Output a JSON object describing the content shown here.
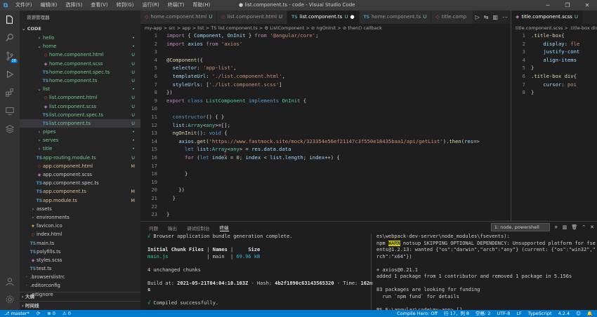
{
  "window": {
    "title": "● list.component.ts - code - Visual Studio Code",
    "menu": [
      "文件(F)",
      "编辑(E)",
      "选择(S)",
      "查看(V)",
      "转到(G)",
      "运行(R)",
      "终端(T)",
      "帮助(H)"
    ]
  },
  "activity": {
    "badge": "28"
  },
  "explorer": {
    "title": "资源管理器",
    "section": "CODE",
    "items": [
      {
        "label": "hello",
        "indent": 1,
        "type": "folder",
        "color": "new",
        "badge": "•"
      },
      {
        "label": "home",
        "indent": 1,
        "type": "folder-open",
        "color": "new",
        "badge": "•"
      },
      {
        "label": "home.component.html",
        "indent": 2,
        "type": "ang",
        "color": "new",
        "badge": "U"
      },
      {
        "label": "home.component.scss",
        "indent": 2,
        "type": "css",
        "color": "new",
        "badge": "U"
      },
      {
        "label": "home.component.spec.ts",
        "indent": 2,
        "type": "ts",
        "color": "new",
        "badge": "U"
      },
      {
        "label": "home.component.ts",
        "indent": 2,
        "type": "ts",
        "color": "new",
        "badge": "U"
      },
      {
        "label": "list",
        "indent": 1,
        "type": "folder-open",
        "color": "new",
        "badge": "•"
      },
      {
        "label": "list.component.html",
        "indent": 2,
        "type": "ang",
        "color": "new",
        "badge": "U"
      },
      {
        "label": "list.component.scss",
        "indent": 2,
        "type": "css",
        "color": "new",
        "badge": "U"
      },
      {
        "label": "list.component.spec.ts",
        "indent": 2,
        "type": "ts",
        "color": "new",
        "badge": "U"
      },
      {
        "label": "list.component.ts",
        "indent": 2,
        "type": "ts",
        "color": "new",
        "badge": "U",
        "selected": true
      },
      {
        "label": "pipes",
        "indent": 1,
        "type": "folder",
        "color": "new",
        "badge": "•"
      },
      {
        "label": "serves",
        "indent": 1,
        "type": "folder",
        "color": "new",
        "badge": "•"
      },
      {
        "label": "title",
        "indent": 1,
        "type": "folder",
        "color": "new",
        "badge": "•"
      },
      {
        "label": "app-routing.module.ts",
        "indent": 1,
        "type": "ts",
        "color": "new",
        "badge": "U"
      },
      {
        "label": "app.component.html",
        "indent": 1,
        "type": "ang",
        "color": "mod",
        "badge": "M"
      },
      {
        "label": "app.component.scss",
        "indent": 1,
        "type": "css",
        "color": "plain",
        "badge": ""
      },
      {
        "label": "app.component.spec.ts",
        "indent": 1,
        "type": "ts",
        "color": "plain",
        "badge": ""
      },
      {
        "label": "app.component.ts",
        "indent": 1,
        "type": "ts",
        "color": "mod",
        "badge": "M"
      },
      {
        "label": "app.module.ts",
        "indent": 1,
        "type": "ts",
        "color": "mod",
        "badge": "M"
      },
      {
        "label": "assets",
        "indent": 0,
        "type": "folder",
        "color": "plain",
        "badge": ""
      },
      {
        "label": "environments",
        "indent": 0,
        "type": "folder",
        "color": "plain",
        "badge": ""
      },
      {
        "label": "favicon.ico",
        "indent": 0,
        "type": "json",
        "color": "plain",
        "badge": ""
      },
      {
        "label": "index.html",
        "indent": 0,
        "type": "html",
        "color": "plain",
        "badge": ""
      },
      {
        "label": "main.ts",
        "indent": 0,
        "type": "ts",
        "color": "plain",
        "badge": ""
      },
      {
        "label": "polyfills.ts",
        "indent": 0,
        "type": "ts",
        "color": "plain",
        "badge": ""
      },
      {
        "label": "styles.scss",
        "indent": 0,
        "type": "css",
        "color": "plain",
        "badge": ""
      },
      {
        "label": "test.ts",
        "indent": 0,
        "type": "ts",
        "color": "plain",
        "badge": ""
      },
      {
        "label": ".browserslistrc",
        "indent": -1,
        "type": "file",
        "color": "plain",
        "badge": ""
      },
      {
        "label": ".editorconfig",
        "indent": -1,
        "type": "file",
        "color": "plain",
        "badge": ""
      },
      {
        "label": ".gitignore",
        "indent": -1,
        "type": "file",
        "color": "plain",
        "badge": ""
      }
    ],
    "outline": "大纲",
    "timeline": "时间线"
  },
  "tabs": [
    {
      "label": "home.component.html",
      "type": "ang",
      "status": "U"
    },
    {
      "label": "list.component.html",
      "type": "ang",
      "status": "U"
    },
    {
      "label": "list.component.ts",
      "type": "ts",
      "status": "U",
      "active": true,
      "dirty": "●"
    },
    {
      "label": "home.component.ts",
      "type": "ts",
      "status": "U"
    },
    {
      "label": "title.comp",
      "type": "ang",
      "status": ""
    }
  ],
  "breadcrumb": "my-app > src > app > list > TS list.component.ts > ⚙ ListComponent > ⊘ ngOnInit > ⊘ then() callback",
  "code": {
    "lines": [
      {
        "n": "1",
        "h": "<span class='k'>import</span> { <span class='v'>Component</span>, <span class='v'>OnInit</span> } <span class='k'>from</span> <span class='s'>'@angular/core'</span>;"
      },
      {
        "n": "2",
        "h": "<span class='k'>import</span> <span class='v'>axios</span> <span class='k'>from</span> <span class='s'>'axios'</span>"
      },
      {
        "n": "3",
        "h": ""
      },
      {
        "n": "4",
        "h": "@<span class='d'>Component</span>({"
      },
      {
        "n": "5",
        "h": "  <span class='v'>selector</span>: <span class='s'>'app-list'</span>,"
      },
      {
        "n": "6",
        "h": "  <span class='v'>templateUrl</span>: <span class='s'>'./list.component.html'</span>,"
      },
      {
        "n": "7",
        "h": "  <span class='v'>styleUrls</span>: [<span class='s'>'./list.component.scss'</span>]"
      },
      {
        "n": "8",
        "h": "})"
      },
      {
        "n": "9",
        "h": "<span class='k'>export</span> <span class='kb'>class</span> <span class='t'>ListComponent</span> <span class='kb'>implements</span> <span class='t'>OnInit</span> {"
      },
      {
        "n": "10",
        "h": ""
      },
      {
        "n": "11",
        "h": "  <span class='kb'>constructor</span>() { }"
      },
      {
        "n": "12",
        "h": "  <span class='v'>list</span>:<span class='t'>Array</span>&lt;<span class='t'>any</span>&gt;=[];"
      },
      {
        "n": "13",
        "h": "  <span class='f'>ngOnInit</span>(): <span class='kb'>void</span> {"
      },
      {
        "n": "14",
        "h": "    <span class='v'>axios</span>.<span class='f'>get</span>(<span class='s'>'https://www.fastmock.site/mock/323354e56ef21147c3f550e18435baa1/api/getList'</span>).<span class='f'>then</span>(<span class='v'>res</span>=&gt;"
      },
      {
        "n": "15",
        "h": "      <span class='kb'>let</span> <span class='v'>list</span>:<span class='t'>Array</span>&lt;<span class='t'>any</span>&gt; = <span class='v'>res</span>.<span class='v'>data</span>.<span class='v'>data</span>"
      },
      {
        "n": "16",
        "h": "      <span class='k'>for</span> (<span class='kb'>let</span> <span class='v'>index</span> = <span class='n'>0</span>; <span class='v'>index</span> &lt; <span class='v'>list</span>.<span class='v'>length</span>; <span class='v'>index</span>++) {"
      },
      {
        "n": "17",
        "h": "        "
      },
      {
        "n": "18",
        "h": "      }"
      },
      {
        "n": "19",
        "h": ""
      },
      {
        "n": "20",
        "h": "    })"
      },
      {
        "n": "21",
        "h": "  }"
      },
      {
        "n": "22",
        "h": ""
      },
      {
        "n": "23",
        "h": "}"
      }
    ]
  },
  "editor2": {
    "tab": "title.component.scss",
    "status": "U",
    "breadcrumb": "title.component.scss > .title-box div",
    "lines": [
      {
        "n": "1",
        "h": ".<span class='d'>title-box</span>{"
      },
      {
        "n": "2",
        "h": "    <span class='v'>display</span>: <span class='s'>fle</span>"
      },
      {
        "n": "3",
        "h": "    <span class='v'>justify-cont</span>"
      },
      {
        "n": "4",
        "h": "    <span class='v'>align-items</span>"
      },
      {
        "n": "5",
        "h": "}"
      },
      {
        "n": "6",
        "h": ".<span class='d'>title-box</span> <span class='d'>div</span>{"
      },
      {
        "n": "7",
        "h": "    <span class='v'>cursor</span>: <span class='s'>poi</span>"
      },
      {
        "n": "8",
        "h": "}"
      }
    ]
  },
  "panel": {
    "tabs": [
      "问题",
      "输出",
      "调试控制台",
      "终端"
    ],
    "active": "终端",
    "terminal_select": "1: node, powershell",
    "left": [
      "<span class='t-green'>√</span> Browser application bundle generation complete.",
      "",
      "<span class='t-bold'>Initial Chunk Files</span> | <span class='t-bold'>Names</span> |     <span class='t-bold'>Size</span>",
      "<span class='t-green'>main.js</span>             | main  | <span class='t-cyan'>69.96 kB</span>",
      "",
      "4 unchanged chunks",
      "",
      "Build at: <span class='t-bold'>2021-05-21T04:04:10.103Z</span> - Hash: <span class='t-bold'>4b2f1890c63143565320</span> - Time: <span class='t-bold'>162m</span>",
      "<span class='t-bold'>s</span>",
      "",
      "<span class='t-green'>√</span> Compiled successfully."
    ],
    "right": [
      "es\\webpack-dev-server\\node_modules\\fsevents):",
      "npm <span class='t-hl'>WARN</span> notsup SKIPPING OPTIONAL DEPENDENCY: Unsupported platform for fsev",
      "ents@1.2.13: wanted {\"os\":\"darwin\",\"arch\":\"any\"} (current: {\"os\":\"win32\",\"a",
      "rch\":\"x64\"})",
      "",
      "+ axios@0.21.1",
      "added 1 package from 1 contributor and removed 1 package in 5.156s",
      "",
      "83 packages are looking for funding",
      "  run `npm fund` for details",
      "",
      "PS E:\\angular\\code\\my-app> []"
    ]
  },
  "status": {
    "branch": "master*",
    "sync": "⟳",
    "errors": "⊗ 0",
    "warnings": "⚠ 0",
    "compile": "Compile Hero: Off",
    "pos": "行 17，列 8",
    "spaces": "空格: 2",
    "enc": "UTF-8",
    "eol": "LF",
    "lang": "TypeScript",
    "ver": "4.2.4"
  },
  "colors": {
    "accent": "#007acc",
    "activity": "#333333",
    "sidebar": "#252526",
    "editor": "#1e1e1e"
  }
}
